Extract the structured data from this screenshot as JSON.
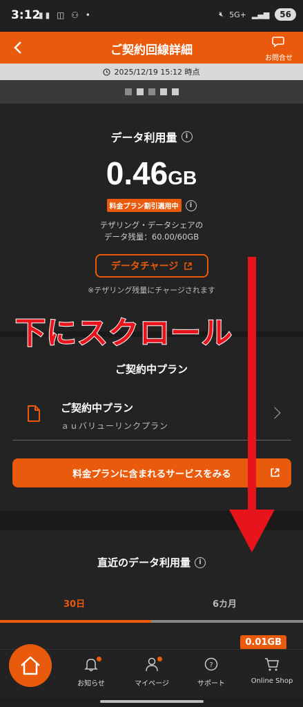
{
  "status_bar": {
    "time": "3:12",
    "network": "5G+",
    "battery": "56"
  },
  "header": {
    "title": "ご契約回線詳細",
    "inquiry_label": "お問合せ"
  },
  "timestamp": "2025/12/19 15:12 時点",
  "data_usage": {
    "title": "データ利用量",
    "amount": "0.46",
    "unit": "GB",
    "discount_badge": "料金プラン割引適用中",
    "tether_line1": "テザリング・データシェアの",
    "tether_line2": "データ残量：60.00/60GB",
    "charge_button": "データチャージ",
    "charge_note": "※テザリング残量にチャージされます"
  },
  "plan": {
    "heading": "ご契約中プラン",
    "item_title": "ご契約中プラン",
    "item_subtitle": "ａｕバリューリンクプラン",
    "services_button": "料金プランに含まれるサービスをみる"
  },
  "recent": {
    "heading": "直近のデータ利用量",
    "tabs": [
      "30日",
      "6カ月"
    ],
    "usage_label": "0.01GB"
  },
  "annotation": {
    "scroll_text": "下にスクロール",
    "arrow_color": "#e8141b"
  },
  "bottom_nav": {
    "items": [
      {
        "label": "お知らせ",
        "icon": "bell-icon"
      },
      {
        "label": "マイページ",
        "icon": "user-icon"
      },
      {
        "label": "サポート",
        "icon": "support-icon"
      },
      {
        "label": "Online Shop",
        "icon": "cart-icon"
      }
    ]
  },
  "colors": {
    "accent": "#ea5a0c",
    "background": "#232323"
  }
}
